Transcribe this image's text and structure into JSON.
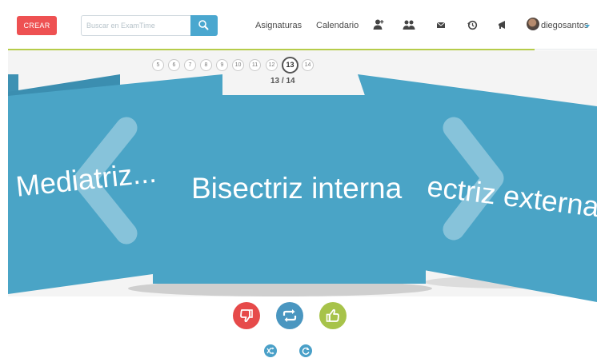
{
  "topbar": {
    "create_label": "CREAR",
    "search_placeholder": "Buscar en ExamTime",
    "nav": [
      "Asignaturas",
      "Calendario"
    ],
    "icons": [
      "add-friend-icon",
      "group-icon",
      "mail-icon",
      "history-icon",
      "megaphone-icon"
    ],
    "user_name": "diegosantos"
  },
  "pager": {
    "pages": [
      "5",
      "6",
      "7",
      "8",
      "9",
      "10",
      "11",
      "12",
      "13",
      "14"
    ],
    "current": "13",
    "count_label": "13 / 14"
  },
  "cards": {
    "previous": "Mediatriz...",
    "current": "Bisectriz interna",
    "next": "Bisectriz externa",
    "next_visible": "ectriz externa"
  },
  "actions": [
    "thumbs-down-icon",
    "repeat-icon",
    "thumbs-up-icon"
  ],
  "controls": [
    "shuffle-icon",
    "refresh-icon"
  ],
  "colors": {
    "card": "#4aa4c6",
    "card_dark": "#3b8eb0",
    "danger": "#e64a4a",
    "primary": "#4a96c0",
    "success": "#a7c34a",
    "accent_line": "#b6cc4a"
  }
}
